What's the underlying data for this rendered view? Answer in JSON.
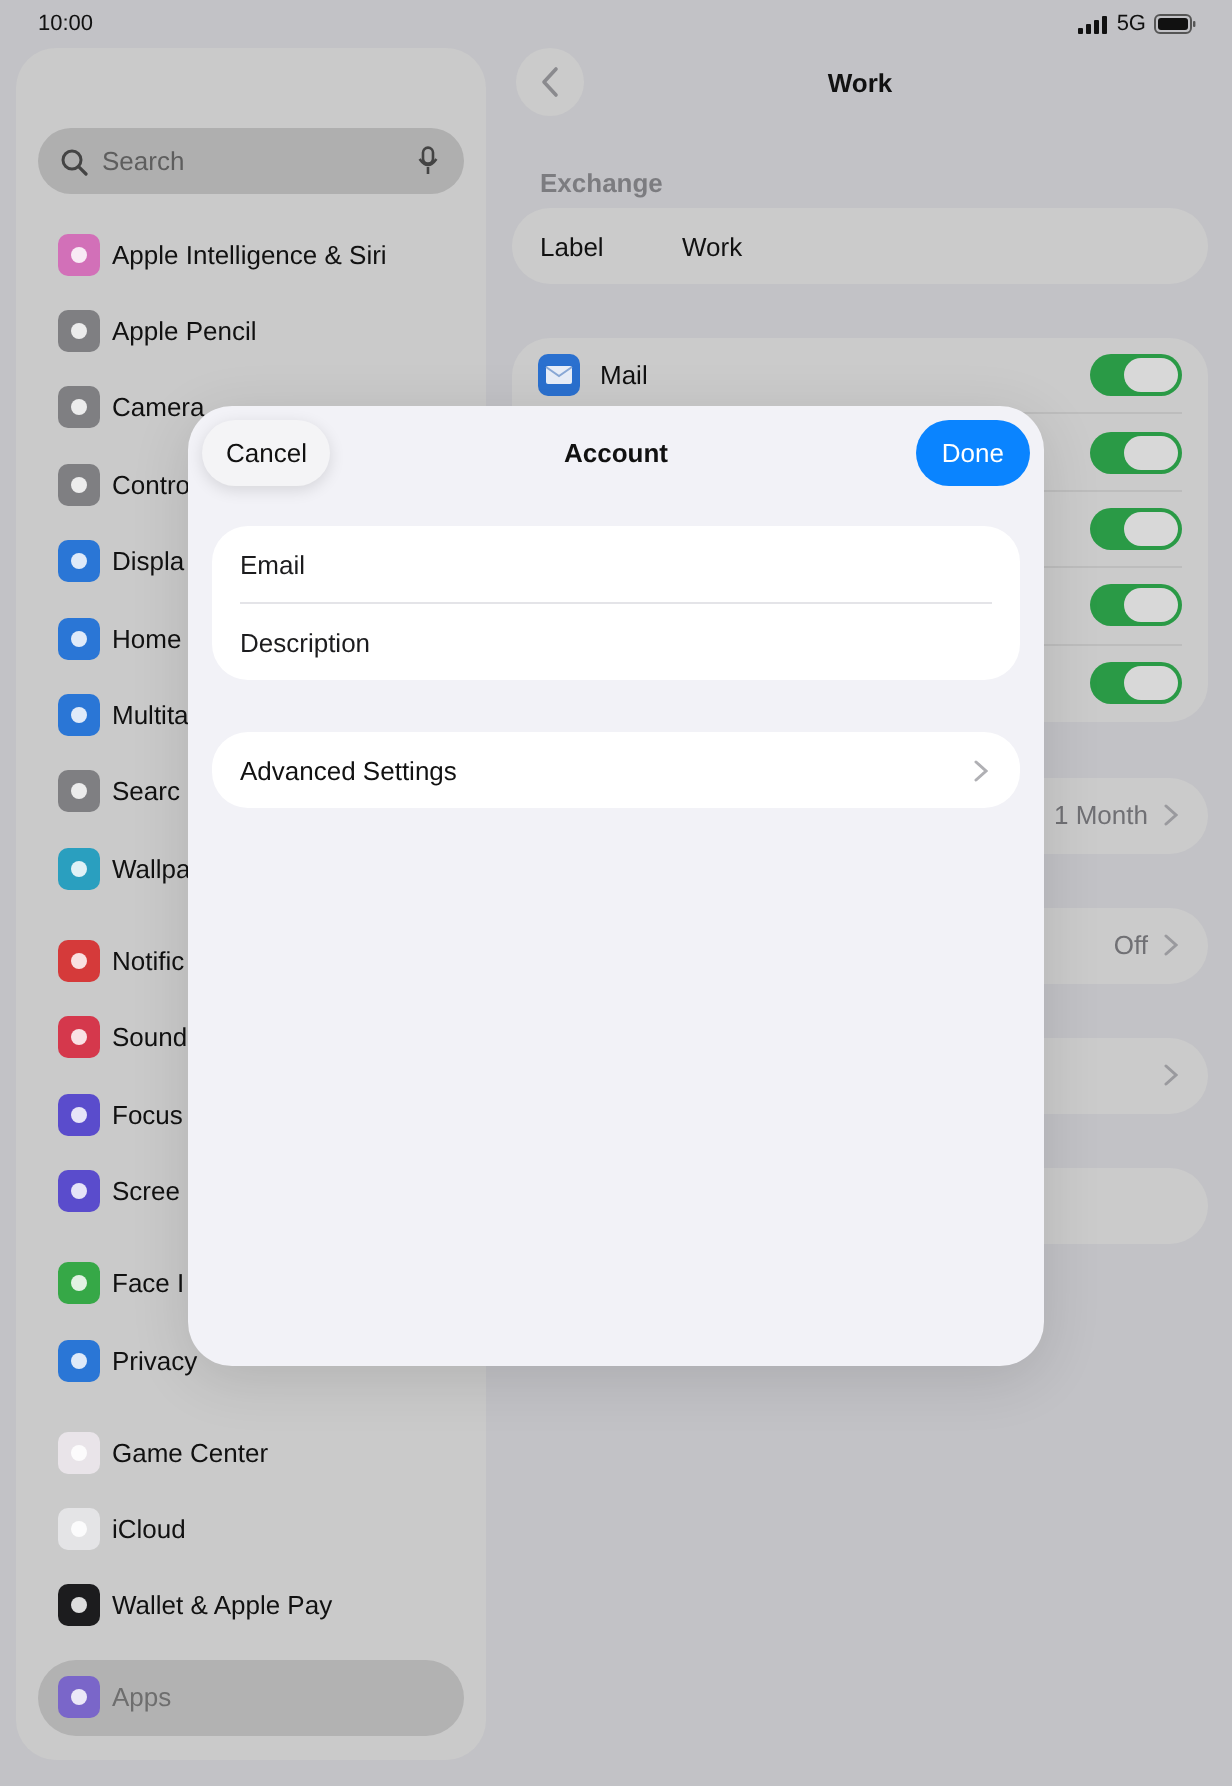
{
  "status_bar": {
    "time": "10:00",
    "network": "5G"
  },
  "sidebar": {
    "search": {
      "placeholder": "Search"
    },
    "groups": [
      {
        "items": [
          {
            "label": "Apple Intelligence & Siri",
            "color": "#d270b8",
            "selected": false
          },
          {
            "label": "Apple Pencil",
            "color": "#7f7f82",
            "selected": false
          },
          {
            "label": "Camera",
            "color": "#7f7f82",
            "selected": false
          },
          {
            "label": "Contro",
            "color": "#7f7f82",
            "selected": false
          },
          {
            "label": "Displa",
            "color": "#2a76d6",
            "selected": false
          },
          {
            "label": "Home",
            "color": "#2a76d6",
            "selected": false
          },
          {
            "label": "Multita",
            "color": "#2a76d6",
            "selected": false
          },
          {
            "label": "Searc",
            "color": "#7f7f82",
            "selected": false
          },
          {
            "label": "Wallpa",
            "color": "#2a9fbf",
            "selected": false
          }
        ]
      },
      {
        "items": [
          {
            "label": "Notific",
            "color": "#d53a3a",
            "selected": false
          },
          {
            "label": "Sound",
            "color": "#d5384c",
            "selected": false
          },
          {
            "label": "Focus",
            "color": "#5a4ccc",
            "selected": false
          },
          {
            "label": "Scree",
            "color": "#5a4ccc",
            "selected": false
          }
        ]
      },
      {
        "items": [
          {
            "label": "Face I",
            "color": "#36a847",
            "selected": false
          },
          {
            "label": "Privacy",
            "color": "#2a76d6",
            "selected": false
          }
        ]
      },
      {
        "items": [
          {
            "label": "Game Center",
            "color": "#e9e4e9",
            "selected": false
          },
          {
            "label": "iCloud",
            "color": "#e4e4e6",
            "selected": false
          },
          {
            "label": "Wallet & Apple Pay",
            "color": "#1c1c1e",
            "selected": false
          }
        ]
      },
      {
        "items": [
          {
            "label": "Apps",
            "color": "#7a66c9",
            "selected": true
          }
        ]
      }
    ]
  },
  "detail": {
    "title": "Work",
    "section_header": "Exchange",
    "label_row": {
      "label": "Label",
      "value": "Work"
    },
    "toggles": [
      {
        "label": "Mail",
        "on": true
      },
      {
        "on": true
      },
      {
        "on": true
      },
      {
        "on": true
      },
      {
        "on": true
      }
    ],
    "rows": [
      {
        "value": "1 Month",
        "chevron": true
      },
      {
        "value": "Off",
        "chevron": true
      },
      {
        "chevron": true
      },
      {
        "chevron": false
      }
    ]
  },
  "modal": {
    "title": "Account",
    "cancel": "Cancel",
    "done": "Done",
    "fields": [
      {
        "placeholder": "Email"
      },
      {
        "placeholder": "Description"
      }
    ],
    "links": [
      {
        "label": "Advanced Settings"
      }
    ]
  }
}
